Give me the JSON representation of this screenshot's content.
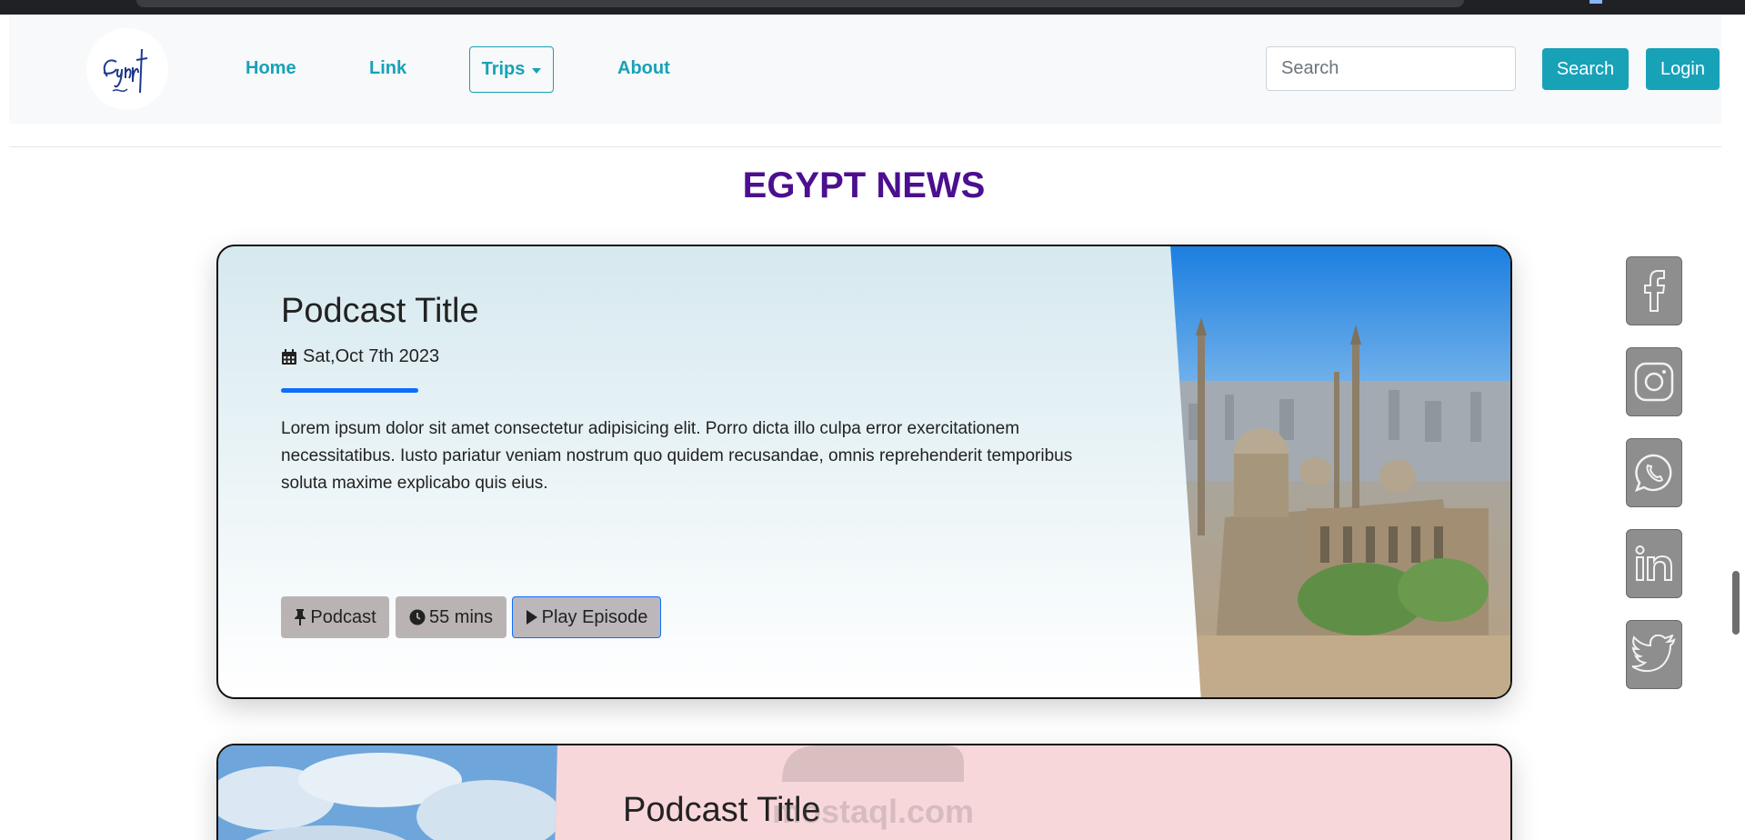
{
  "colors": {
    "accent": "#17a2b8",
    "title": "#4b0f8f",
    "progress": "#0d6efd",
    "tag": "#bab3b3",
    "social": "#8e8e8e",
    "card2_bg": "#f8d7da"
  },
  "navbar": {
    "logo_text": "Egypt",
    "links": [
      {
        "label": "Home"
      },
      {
        "label": "Link"
      },
      {
        "label": "About"
      }
    ],
    "dropdown": {
      "label": "Trips"
    },
    "search": {
      "placeholder": "Search",
      "value": ""
    },
    "search_button": "Search",
    "login_button": "Login"
  },
  "main": {
    "section_title": "EGYPT NEWS",
    "cards": [
      {
        "title": "Podcast Title",
        "date": "Sat,Oct 7th 2023",
        "text": "Lorem ipsum dolor sit amet consectetur adipisicing elit. Porro dicta illo culpa error exercitationem necessitatibus. Iusto pariatur veniam nostrum quo quidem recusandae, omnis reprehenderit temporibus soluta maxime explicabo quis eius.",
        "tags": [
          "Podcast",
          "55 mins",
          "Play Episode"
        ],
        "image": "cairo-mosque-skyline"
      },
      {
        "title": "Podcast Title",
        "image": "cloudy-sky"
      }
    ]
  },
  "social": [
    {
      "icon": "facebook-icon"
    },
    {
      "icon": "instagram-icon"
    },
    {
      "icon": "whatsapp-icon"
    },
    {
      "icon": "linkedin-icon"
    },
    {
      "icon": "twitter-icon"
    }
  ],
  "watermark": {
    "text": "mostaql.com"
  }
}
